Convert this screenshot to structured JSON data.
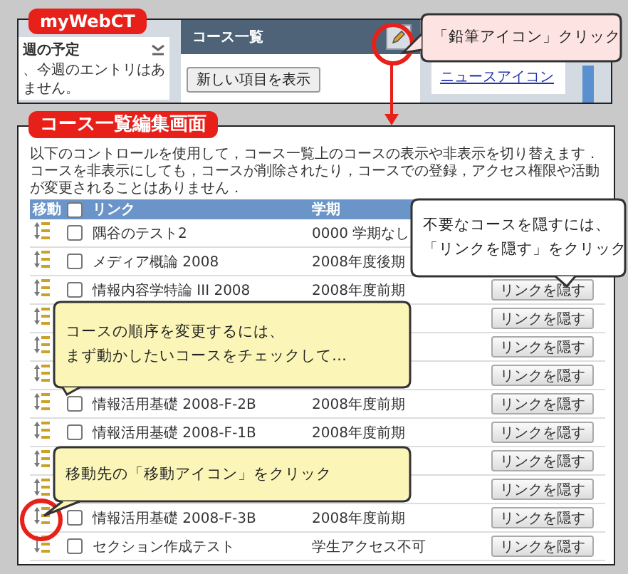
{
  "top_panel": {
    "label": "myWebCT",
    "left_column": {
      "title": "週の予定",
      "text_lines": [
        "、今週のエントリはあ",
        "ません。"
      ]
    },
    "course_list": {
      "title": "コース一覧",
      "button": "新しい項目を表示"
    },
    "right_column": {
      "link": "ニュースアイコン"
    }
  },
  "edit_panel": {
    "label": "コース一覧編集画面",
    "description": "以下のコントロールを使用して，コース一覧上のコースの表示や非表示を切り替えます．コースを非表示にしても，コースが削除されたり，コースでの登録，アクセス権限や活動が変更されることはありません．",
    "table": {
      "columns": [
        "移動",
        "リンク",
        "学期"
      ],
      "select_all_checked": false,
      "rows": [
        {
          "name": "隅谷のテスト2",
          "term": "0000 学期なし",
          "checked": false
        },
        {
          "name": "メディア概論 2008",
          "term": "2008年度後期",
          "checked": false
        },
        {
          "name": "情報内容学特論 III 2008",
          "term": "2008年度前期",
          "checked": false,
          "button": "リンクを隠す"
        },
        {
          "button": "リンクを隠す"
        },
        {
          "button": "リンクを隠す"
        },
        {
          "button": "リンクを隠す"
        },
        {
          "name": "情報活用基礎 2008-F-2B",
          "term": "2008年度前期",
          "checked": false,
          "button": "リンクを隠す"
        },
        {
          "name": "情報活用基礎 2008-F-1B",
          "term": "2008年度前期",
          "checked": false,
          "button": "リンクを隠す"
        },
        {
          "button": "リンクを隠す"
        },
        {
          "button": "リンクを隠す"
        },
        {
          "name": "情報活用基礎 2008-F-3B",
          "term": "2008年度前期",
          "checked": false,
          "button": "リンクを隠す"
        },
        {
          "name": "セクション作成テスト",
          "term": "学生アクセス不可",
          "checked": false,
          "button": "リンクを隠す"
        }
      ]
    }
  },
  "callouts": [
    {
      "kind": "pink",
      "lines": [
        "「鉛筆アイコン」クリック"
      ]
    },
    {
      "kind": "white",
      "lines": [
        "不要なコースを隠すには、",
        "「リンクを隠す」をクリック"
      ]
    },
    {
      "kind": "yellow",
      "lines": [
        "コースの順序を変更するには、",
        "まず動かしたいコースをチェックして…"
      ]
    },
    {
      "kind": "yellow",
      "lines": [
        "移動先の「移動アイコン」をクリック"
      ]
    }
  ]
}
